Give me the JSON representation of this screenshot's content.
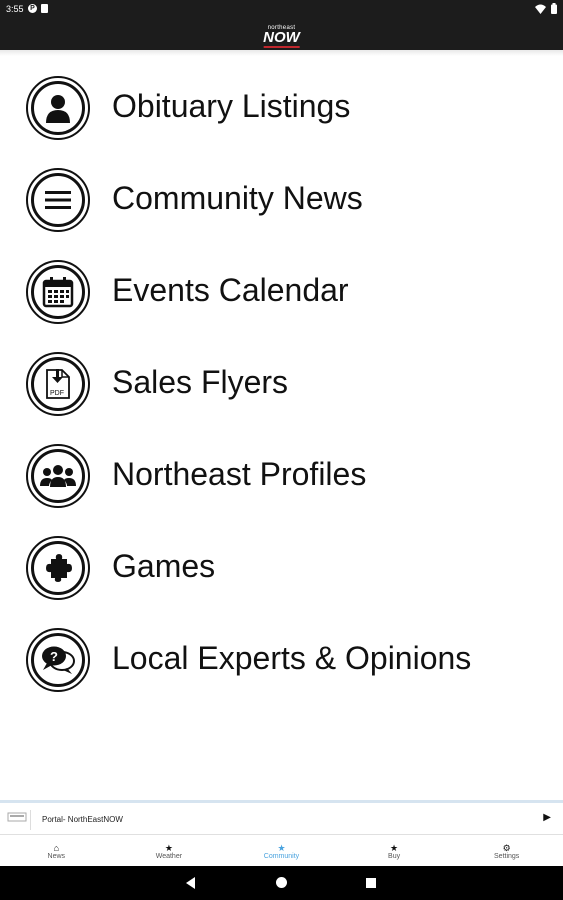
{
  "status_bar": {
    "time": "3:55"
  },
  "app_bar": {
    "logo_top": "northeast",
    "logo_main": "NOW"
  },
  "menu": {
    "items": [
      {
        "label": "Obituary Listings",
        "icon": "person-icon"
      },
      {
        "label": "Community News",
        "icon": "menu-lines-icon"
      },
      {
        "label": "Events Calendar",
        "icon": "calendar-icon"
      },
      {
        "label": "Sales Flyers",
        "icon": "pdf-download-icon"
      },
      {
        "label": "Northeast Profiles",
        "icon": "people-group-icon"
      },
      {
        "label": "Games",
        "icon": "puzzle-icon"
      },
      {
        "label": "Local Experts & Opinions",
        "icon": "chat-question-icon"
      }
    ]
  },
  "banner": {
    "text": "Portal- NorthEastNOW"
  },
  "bottom_nav": {
    "items": [
      {
        "label": "News",
        "icon": "home-icon"
      },
      {
        "label": "Weather",
        "icon": "star-icon"
      },
      {
        "label": "Community",
        "icon": "star-icon",
        "active": true
      },
      {
        "label": "Buy",
        "icon": "star-icon"
      },
      {
        "label": "Settings",
        "icon": "gear-icon"
      }
    ]
  },
  "colors": {
    "active_tab": "#4aa3df",
    "bars": "#1c1c1c",
    "logo_accent": "#c0272d"
  }
}
